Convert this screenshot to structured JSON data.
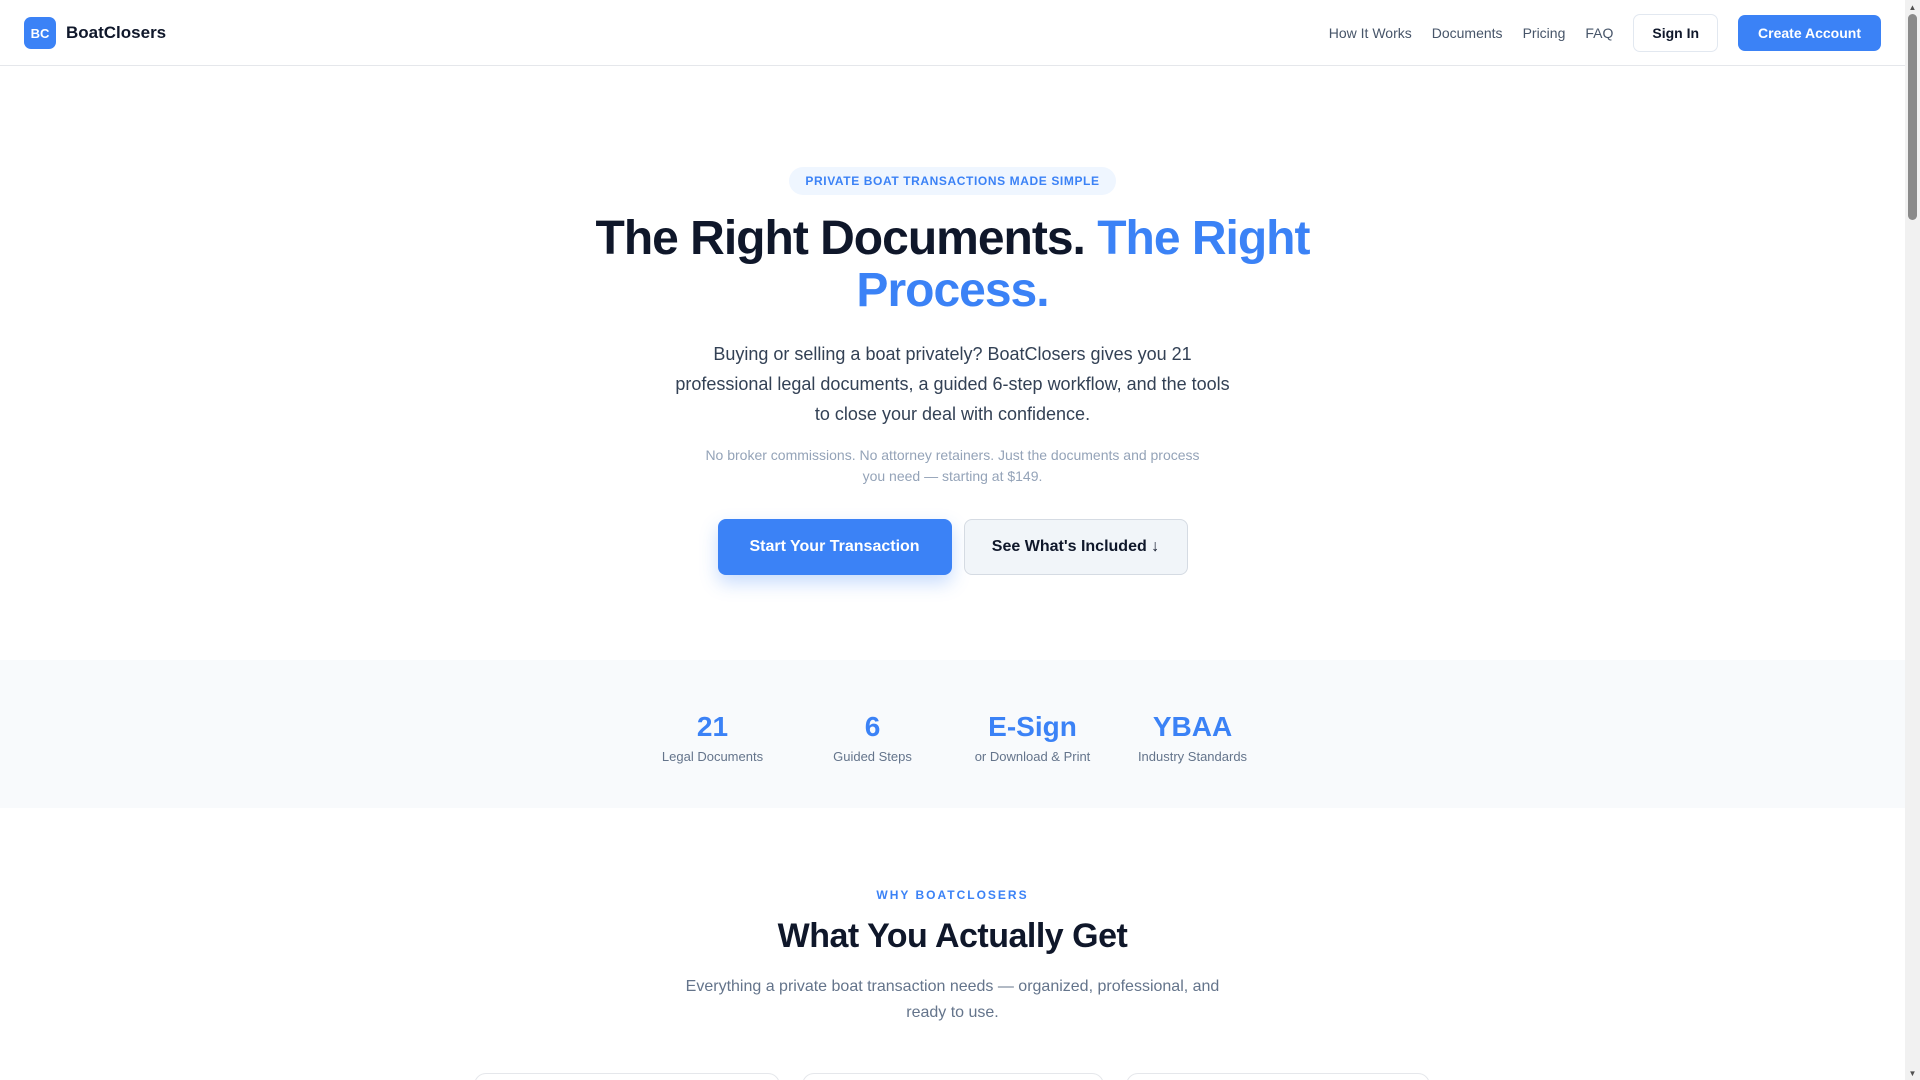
{
  "nav": {
    "logo_badge": "BC",
    "brand": "BoatClosers",
    "links": [
      "How It Works",
      "Documents",
      "Pricing",
      "FAQ"
    ],
    "sign_in": "Sign In",
    "create_account": "Create Account"
  },
  "hero": {
    "pill": "PRIVATE BOAT TRANSACTIONS MADE SIMPLE",
    "title_main": "The Right Documents.",
    "title_accent": "The Right Process.",
    "subtitle": "Buying or selling a boat privately? BoatClosers gives you 21 professional legal documents, a guided 6-step workflow, and the tools to close your deal with confidence.",
    "note": "No broker commissions. No attorney retainers. Just the documents and process you need — starting at $149.",
    "primary_cta": "Start Your Transaction",
    "secondary_cta": "See What's Included ↓"
  },
  "stats": [
    {
      "value": "21",
      "label": "Legal Documents"
    },
    {
      "value": "6",
      "label": "Guided Steps"
    },
    {
      "value": "E-Sign",
      "label": "or Download & Print"
    },
    {
      "value": "YBAA",
      "label": "Industry Standards"
    }
  ],
  "why": {
    "eyebrow": "WHY BOATCLOSERS",
    "title": "What You Actually Get",
    "subtitle": "Everything a private boat transaction needs — organized, professional, and ready to use."
  },
  "colors": {
    "accent": "#3b82f6",
    "text": "#0f172a",
    "muted": "#64748b"
  }
}
